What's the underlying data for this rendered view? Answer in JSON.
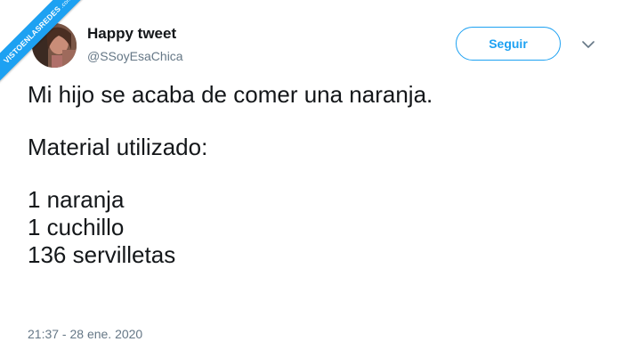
{
  "watermark": {
    "text": "VISTOENLASREDES",
    "suffix": ".com"
  },
  "tweet": {
    "author_name": "Happy tweet",
    "author_handle": "@SSoyEsaChica",
    "follow_label": "Seguir",
    "menu_icon": "chevron-down-icon",
    "paragraphs": [
      [
        "Mi hijo se acaba de comer una naranja."
      ],
      [
        "Material utilizado:"
      ],
      [
        "1 naranja",
        "1 cuchillo",
        "136 servilletas"
      ]
    ],
    "timestamp": "21:37 - 28 ene. 2020"
  },
  "colors": {
    "accent": "#1da1f2",
    "text": "#14171a",
    "muted": "#657786"
  }
}
